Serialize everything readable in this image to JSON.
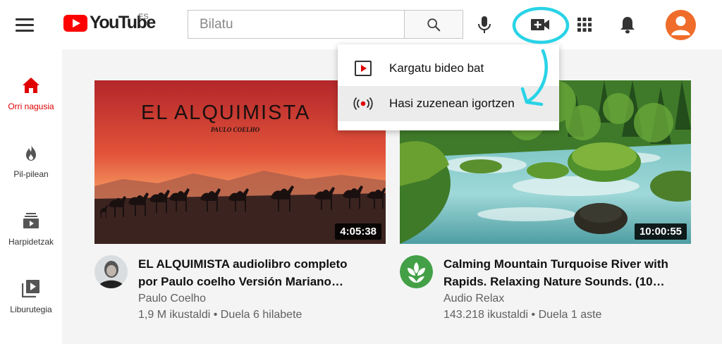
{
  "header": {
    "logo_text": "YouTube",
    "country": "ES",
    "search_placeholder": "Bilatu"
  },
  "sidebar": {
    "items": [
      {
        "label": "Orri nagusia",
        "icon": "home-icon",
        "active": true
      },
      {
        "label": "Pil-pilean",
        "icon": "fire-icon",
        "active": false
      },
      {
        "label": "Harpidetzak",
        "icon": "subscriptions-icon",
        "active": false
      },
      {
        "label": "Liburutegia",
        "icon": "library-icon",
        "active": false
      }
    ]
  },
  "create_menu": {
    "items": [
      {
        "label": "Kargatu bideo bat",
        "icon": "upload-video-icon"
      },
      {
        "label": "Hasi zuzenean igortzen",
        "icon": "go-live-icon"
      }
    ]
  },
  "videos": [
    {
      "thumb_title": "EL ALQUIMISTA",
      "thumb_subtitle": "PAULO COELHO",
      "duration": "4:05:38",
      "title_line1": "EL ALQUIMISTA audiolibro completo",
      "title_line2": "por Paulo coelho Versión Mariano…",
      "channel": "Paulo Coelho",
      "views": "1,9 M ikustaldi",
      "age": "Duela 6 hilabete"
    },
    {
      "duration": "10:00:55",
      "title_line1": "Calming Mountain Turquoise River with",
      "title_line2": "Rapids. Relaxing Nature Sounds. (10…",
      "channel": "Audio Relax",
      "views": "143.218 ikustaldi",
      "age": "Duela 1 aste"
    }
  ],
  "colors": {
    "brand_red": "#ff0000",
    "annotation": "#29d3e6",
    "avatar": "#ef6c2b"
  }
}
